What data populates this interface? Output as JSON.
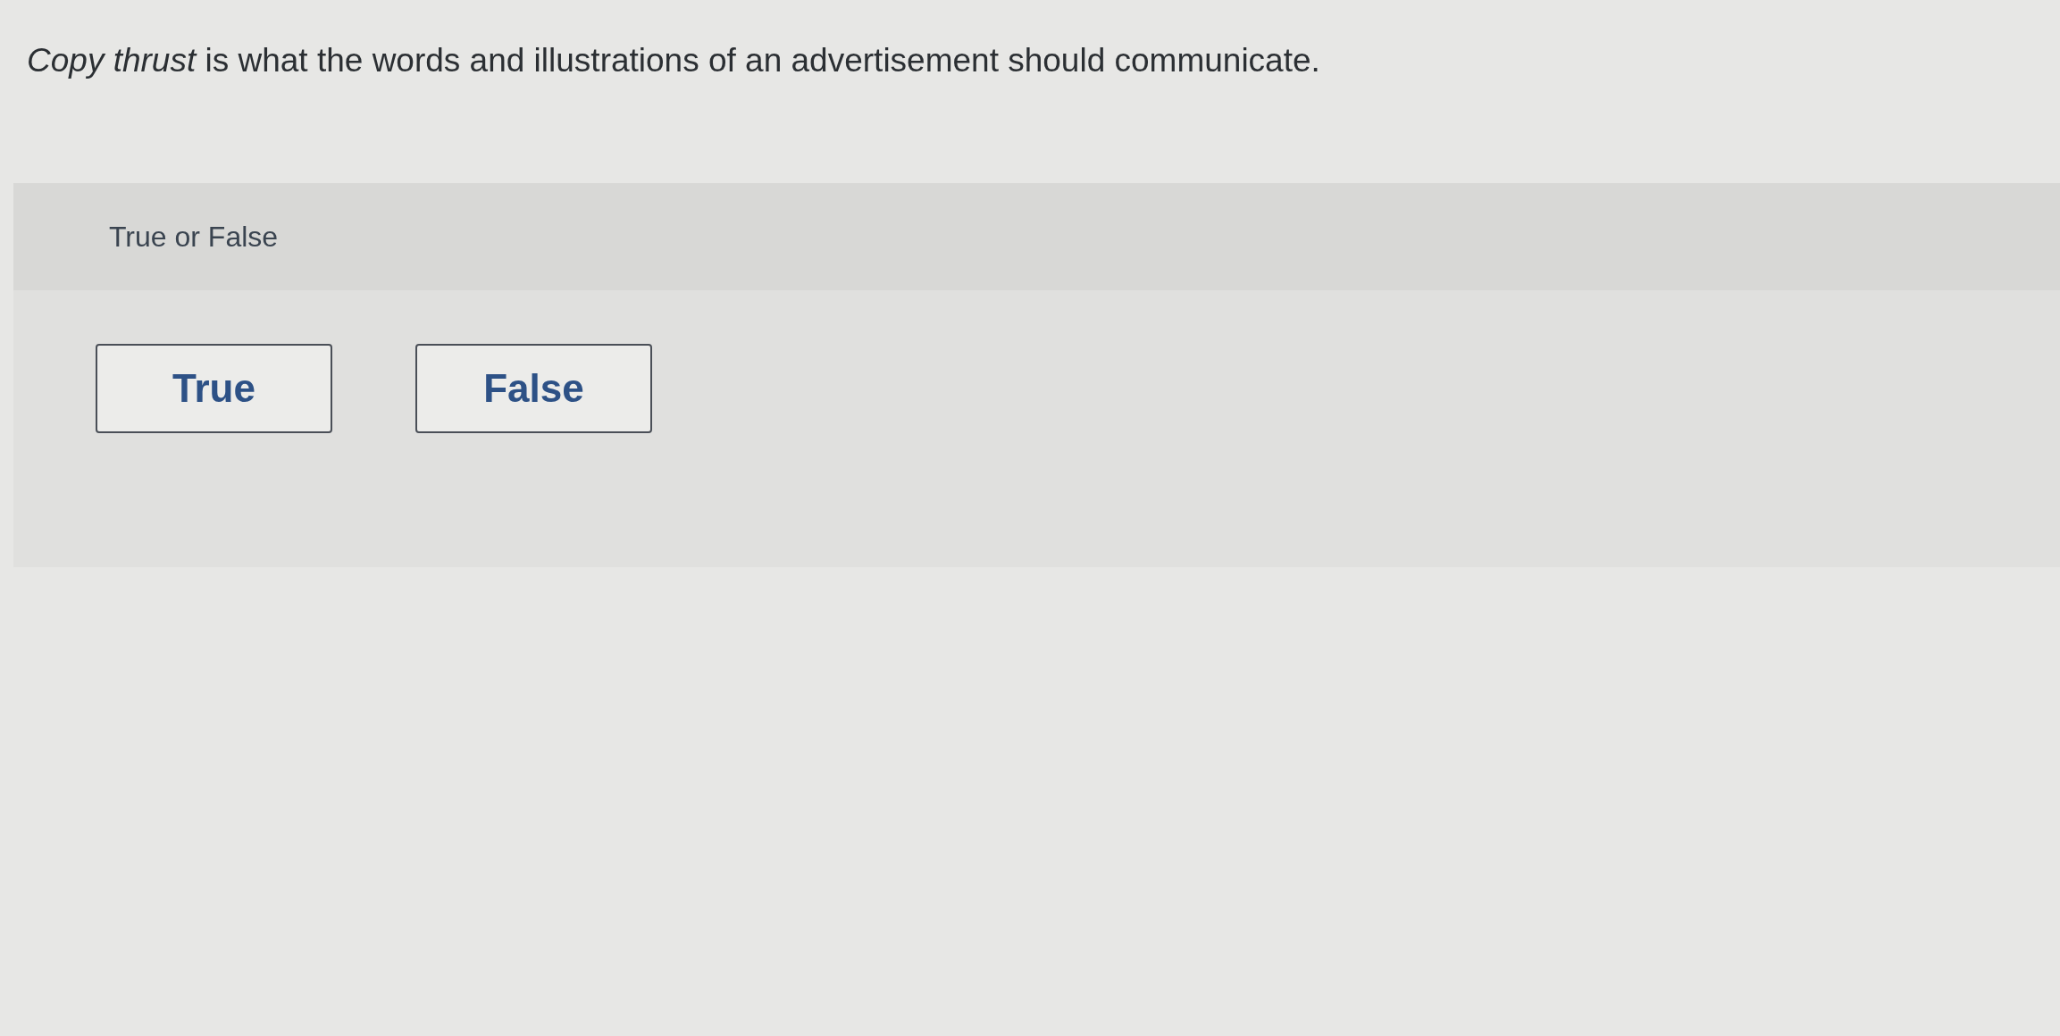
{
  "question": {
    "text": "*Copy thrust* is what the words and illustrations of an advertisement should communicate."
  },
  "answer_panel": {
    "prompt": "True or False",
    "options": [
      {
        "label": "True",
        "selected": false
      },
      {
        "label": "False",
        "selected": false
      }
    ]
  }
}
